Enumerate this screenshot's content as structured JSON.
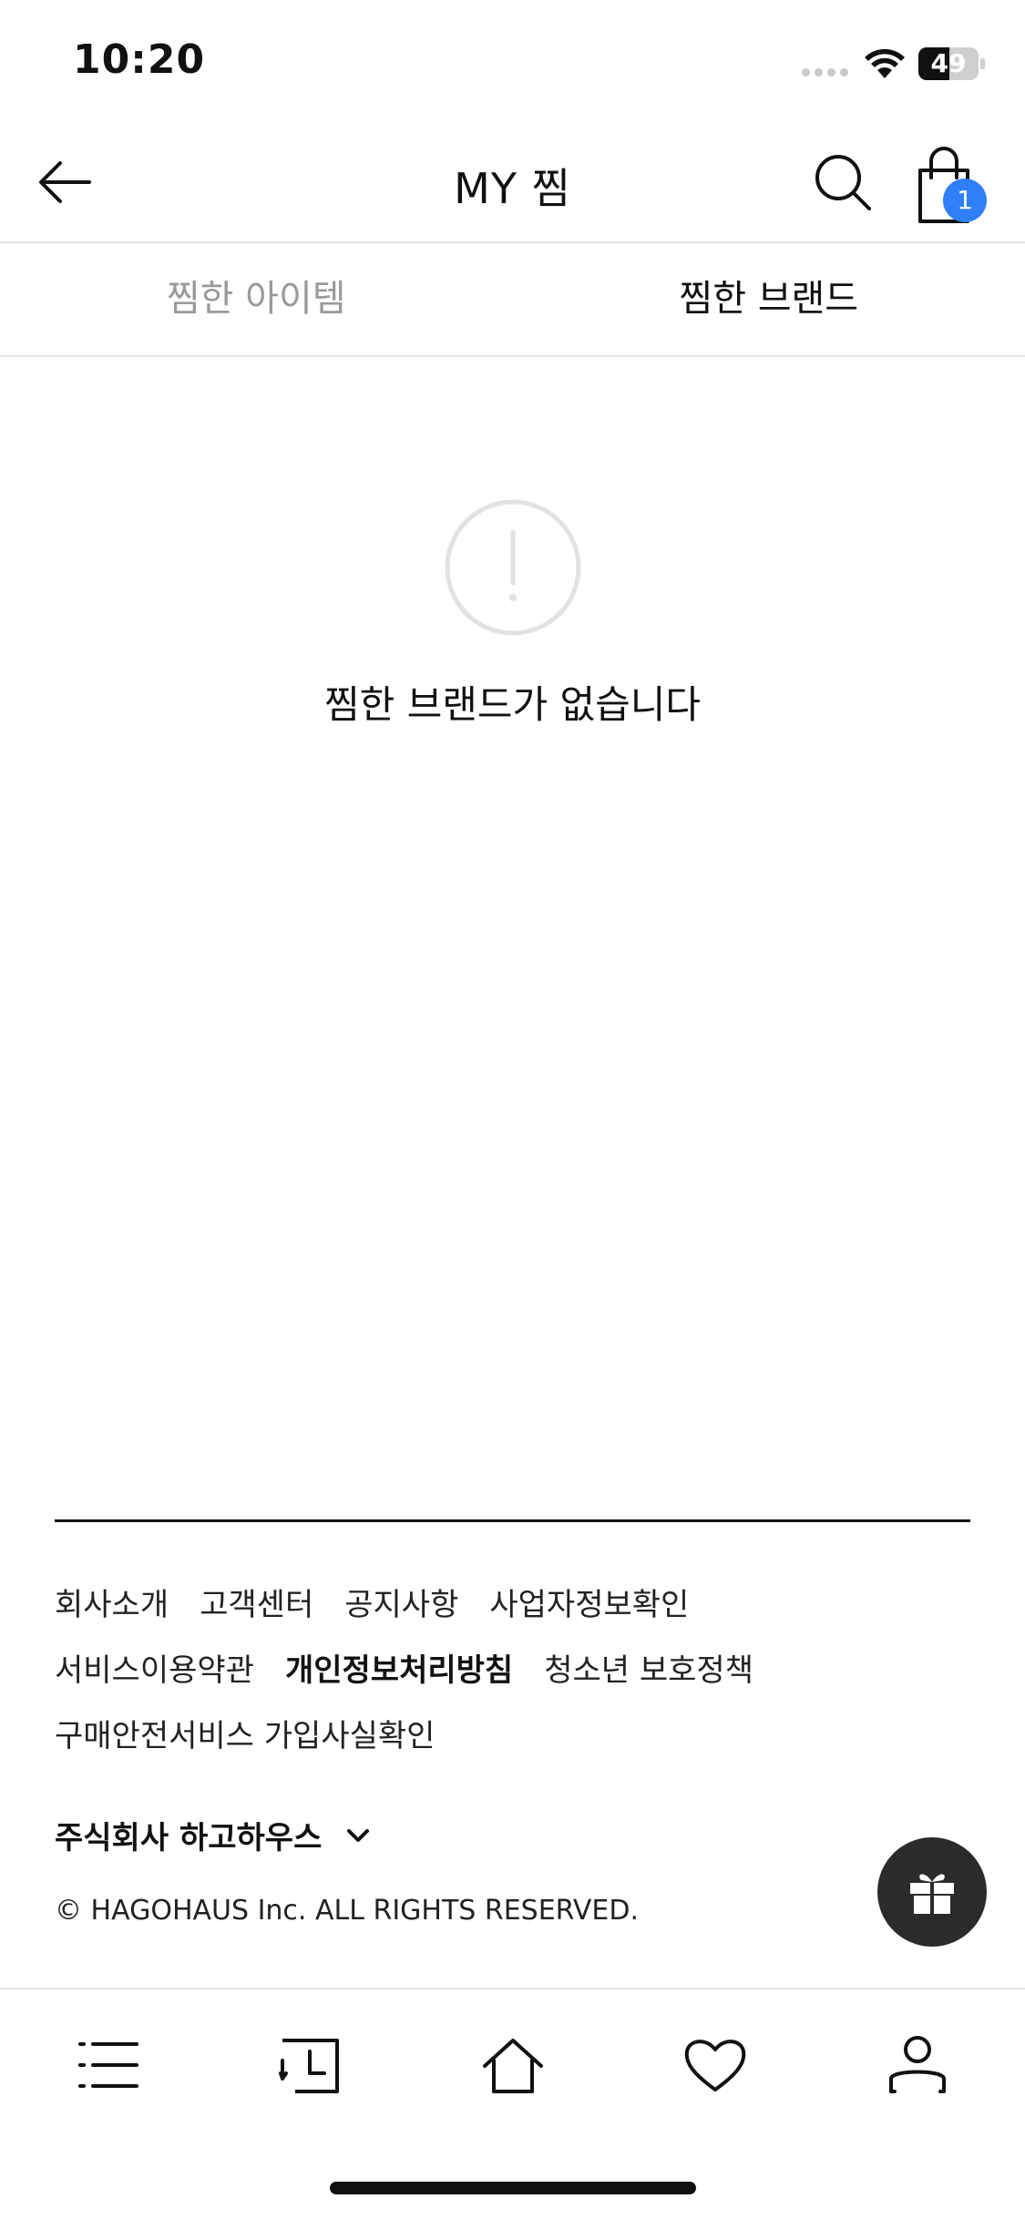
{
  "status_bar": {
    "time": "10:20",
    "battery": "49"
  },
  "header": {
    "title": "MY 찜",
    "cart_count": "1"
  },
  "tabs": [
    {
      "label": "찜한 아이템",
      "active": false
    },
    {
      "label": "찜한 브랜드",
      "active": true
    }
  ],
  "empty_state": {
    "message": "찜한 브랜드가 없습니다"
  },
  "footer": {
    "links_row1": [
      "회사소개",
      "고객센터",
      "공지사항",
      "사업자정보확인"
    ],
    "links_row2": [
      "서비스이용약관",
      "개인정보처리방침",
      "청소년 보호정책"
    ],
    "links_row3": [
      "구매안전서비스 가입사실확인"
    ],
    "company_name": "주식회사 하고하우스",
    "copyright": "© HAGOHAUS Inc. ALL RIGHTS RESERVED."
  },
  "icons": {
    "back": "arrow-left-icon",
    "search": "search-icon",
    "cart": "shopping-bag-icon",
    "empty": "exclamation-circle-icon",
    "gift": "gift-icon",
    "nav": [
      "menu-icon",
      "recent-icon",
      "home-icon",
      "heart-icon",
      "user-icon"
    ]
  },
  "colors": {
    "badge": "#2f80f6",
    "gift_button": "#2b2b2b",
    "inactive_tab": "#9a9a9a"
  }
}
